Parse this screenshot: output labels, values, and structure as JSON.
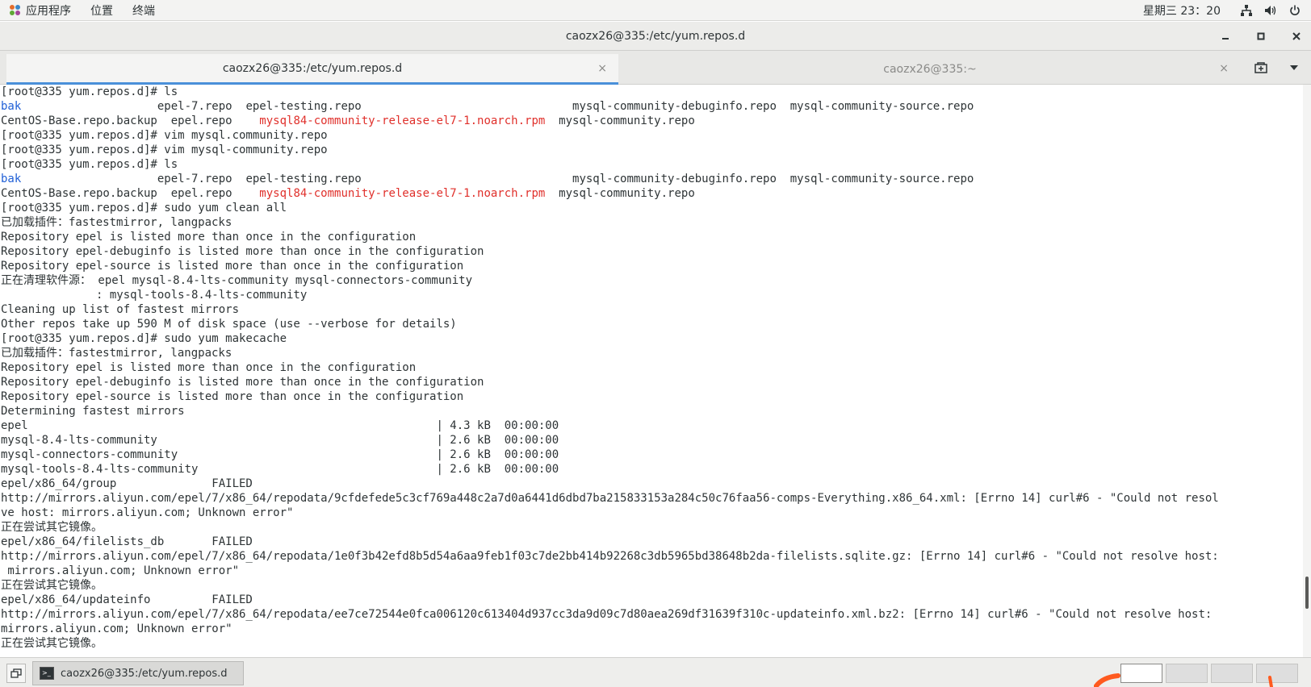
{
  "top_panel": {
    "menus": [
      "应用程序",
      "位置",
      "终端"
    ],
    "clock": "星期三 23：20"
  },
  "window": {
    "title": "caozx26@335:/etc/yum.repos.d"
  },
  "tabs": [
    {
      "label": "caozx26@335:/etc/yum.repos.d",
      "active": true
    },
    {
      "label": "caozx26@335:~",
      "active": false
    }
  ],
  "terminal": {
    "lines": [
      [
        {
          "t": "[root@335 yum.repos.d]# ls"
        }
      ],
      [
        {
          "t": "bak",
          "c": "dir"
        },
        {
          "t": "                    epel-7.repo  epel-testing.repo                               mysql-community-debuginfo.repo  mysql-community-source.repo"
        }
      ],
      [
        {
          "t": "CentOS-Base.repo.backup  epel.repo    "
        },
        {
          "t": "mysql84-community-release-el7-1.noarch.rpm",
          "c": "rpm"
        },
        {
          "t": "  mysql-community.repo"
        }
      ],
      [
        {
          "t": "[root@335 yum.repos.d]# vim mysql.community.repo"
        }
      ],
      [
        {
          "t": "[root@335 yum.repos.d]# vim mysql-community.repo"
        }
      ],
      [
        {
          "t": "[root@335 yum.repos.d]# ls"
        }
      ],
      [
        {
          "t": "bak",
          "c": "dir"
        },
        {
          "t": "                    epel-7.repo  epel-testing.repo                               mysql-community-debuginfo.repo  mysql-community-source.repo"
        }
      ],
      [
        {
          "t": "CentOS-Base.repo.backup  epel.repo    "
        },
        {
          "t": "mysql84-community-release-el7-1.noarch.rpm",
          "c": "rpm"
        },
        {
          "t": "  mysql-community.repo"
        }
      ],
      [
        {
          "t": "[root@335 yum.repos.d]# sudo yum clean all"
        }
      ],
      [
        {
          "t": "已加载插件：fastestmirror, langpacks"
        }
      ],
      [
        {
          "t": "Repository epel is listed more than once in the configuration"
        }
      ],
      [
        {
          "t": "Repository epel-debuginfo is listed more than once in the configuration"
        }
      ],
      [
        {
          "t": "Repository epel-source is listed more than once in the configuration"
        }
      ],
      [
        {
          "t": "正在清理软件源： epel mysql-8.4-lts-community mysql-connectors-community"
        }
      ],
      [
        {
          "t": "              : mysql-tools-8.4-lts-community"
        }
      ],
      [
        {
          "t": "Cleaning up list of fastest mirrors"
        }
      ],
      [
        {
          "t": "Other repos take up 590 M of disk space (use --verbose for details)"
        }
      ],
      [
        {
          "t": "[root@335 yum.repos.d]# sudo yum makecache"
        }
      ],
      [
        {
          "t": "已加载插件：fastestmirror, langpacks"
        }
      ],
      [
        {
          "t": "Repository epel is listed more than once in the configuration"
        }
      ],
      [
        {
          "t": "Repository epel-debuginfo is listed more than once in the configuration"
        }
      ],
      [
        {
          "t": "Repository epel-source is listed more than once in the configuration"
        }
      ],
      [
        {
          "t": "Determining fastest mirrors"
        }
      ],
      [
        {
          "t": "epel                                                            | 4.3 kB  00:00:00"
        }
      ],
      [
        {
          "t": "mysql-8.4-lts-community                                         | 2.6 kB  00:00:00"
        }
      ],
      [
        {
          "t": "mysql-connectors-community                                      | 2.6 kB  00:00:00"
        }
      ],
      [
        {
          "t": "mysql-tools-8.4-lts-community                                   | 2.6 kB  00:00:00"
        }
      ],
      [
        {
          "t": "epel/x86_64/group              FAILED"
        }
      ],
      [
        {
          "t": "http://mirrors.aliyun.com/epel/7/x86_64/repodata/9cfdefede5c3cf769a448c2a7d0a6441d6dbd7ba215833153a284c50c76faa56-comps-Everything.x86_64.xml: [Errno 14] curl#6 - \"Could not resol"
        }
      ],
      [
        {
          "t": "ve host: mirrors.aliyun.com; Unknown error\""
        }
      ],
      [
        {
          "t": "正在尝试其它镜像。"
        }
      ],
      [
        {
          "t": "epel/x86_64/filelists_db       FAILED"
        }
      ],
      [
        {
          "t": "http://mirrors.aliyun.com/epel/7/x86_64/repodata/1e0f3b42efd8b5d54a6aa9feb1f03c7de2bb414b92268c3db5965bd38648b2da-filelists.sqlite.gz: [Errno 14] curl#6 - \"Could not resolve host:"
        }
      ],
      [
        {
          "t": " mirrors.aliyun.com; Unknown error\""
        }
      ],
      [
        {
          "t": "正在尝试其它镜像。"
        }
      ],
      [
        {
          "t": "epel/x86_64/updateinfo         FAILED"
        }
      ],
      [
        {
          "t": "http://mirrors.aliyun.com/epel/7/x86_64/repodata/ee7ce72544e0fca006120c613404d937cc3da9d09c7d80aea269df31639f310c-updateinfo.xml.bz2: [Errno 14] curl#6 - \"Could not resolve host:"
        }
      ],
      [
        {
          "t": "mirrors.aliyun.com; Unknown error\""
        }
      ],
      [
        {
          "t": "正在尝试其它镜像。"
        }
      ]
    ]
  },
  "taskbar": {
    "task_label": "caozx26@335:/etc/yum.repos.d"
  },
  "colors": {
    "directory": "#1f5fd6",
    "rpm_file": "#e0302b",
    "tab_accent": "#4a90d9"
  },
  "icons": [
    "apps-icon",
    "network-icon",
    "volume-icon",
    "power-icon",
    "minimize-icon",
    "maximize-icon",
    "close-icon",
    "new-tab-icon",
    "tab-menu-icon",
    "show-desktop-icon",
    "terminal-icon"
  ]
}
